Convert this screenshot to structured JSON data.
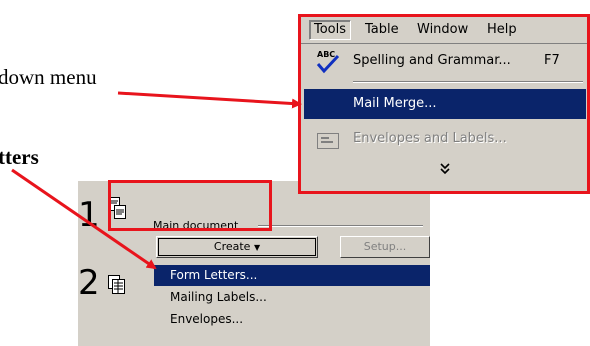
{
  "annotations": {
    "line1": "down menu",
    "line2": "tters"
  },
  "menubar": {
    "tools": "Tools",
    "table": "Table",
    "window": "Window",
    "help": "Help"
  },
  "tools_menu": {
    "spelling": "Spelling and Grammar...",
    "spelling_shortcut": "F7",
    "mail_merge": "Mail Merge...",
    "envelopes": "Envelopes and Labels...",
    "more": "»"
  },
  "mail_merge_helper": {
    "step1": "1",
    "step2": "2",
    "main_document": "Main document",
    "create_label": "Create",
    "setup_label": "Setup...",
    "create_menu": {
      "form_letters": "Form Letters...",
      "mailing_labels": "Mailing Labels...",
      "envelopes": "Envelopes..."
    }
  },
  "colors": {
    "highlight": "#0a246a",
    "face": "#d4d0c8",
    "annotation_red": "#e8141c"
  }
}
